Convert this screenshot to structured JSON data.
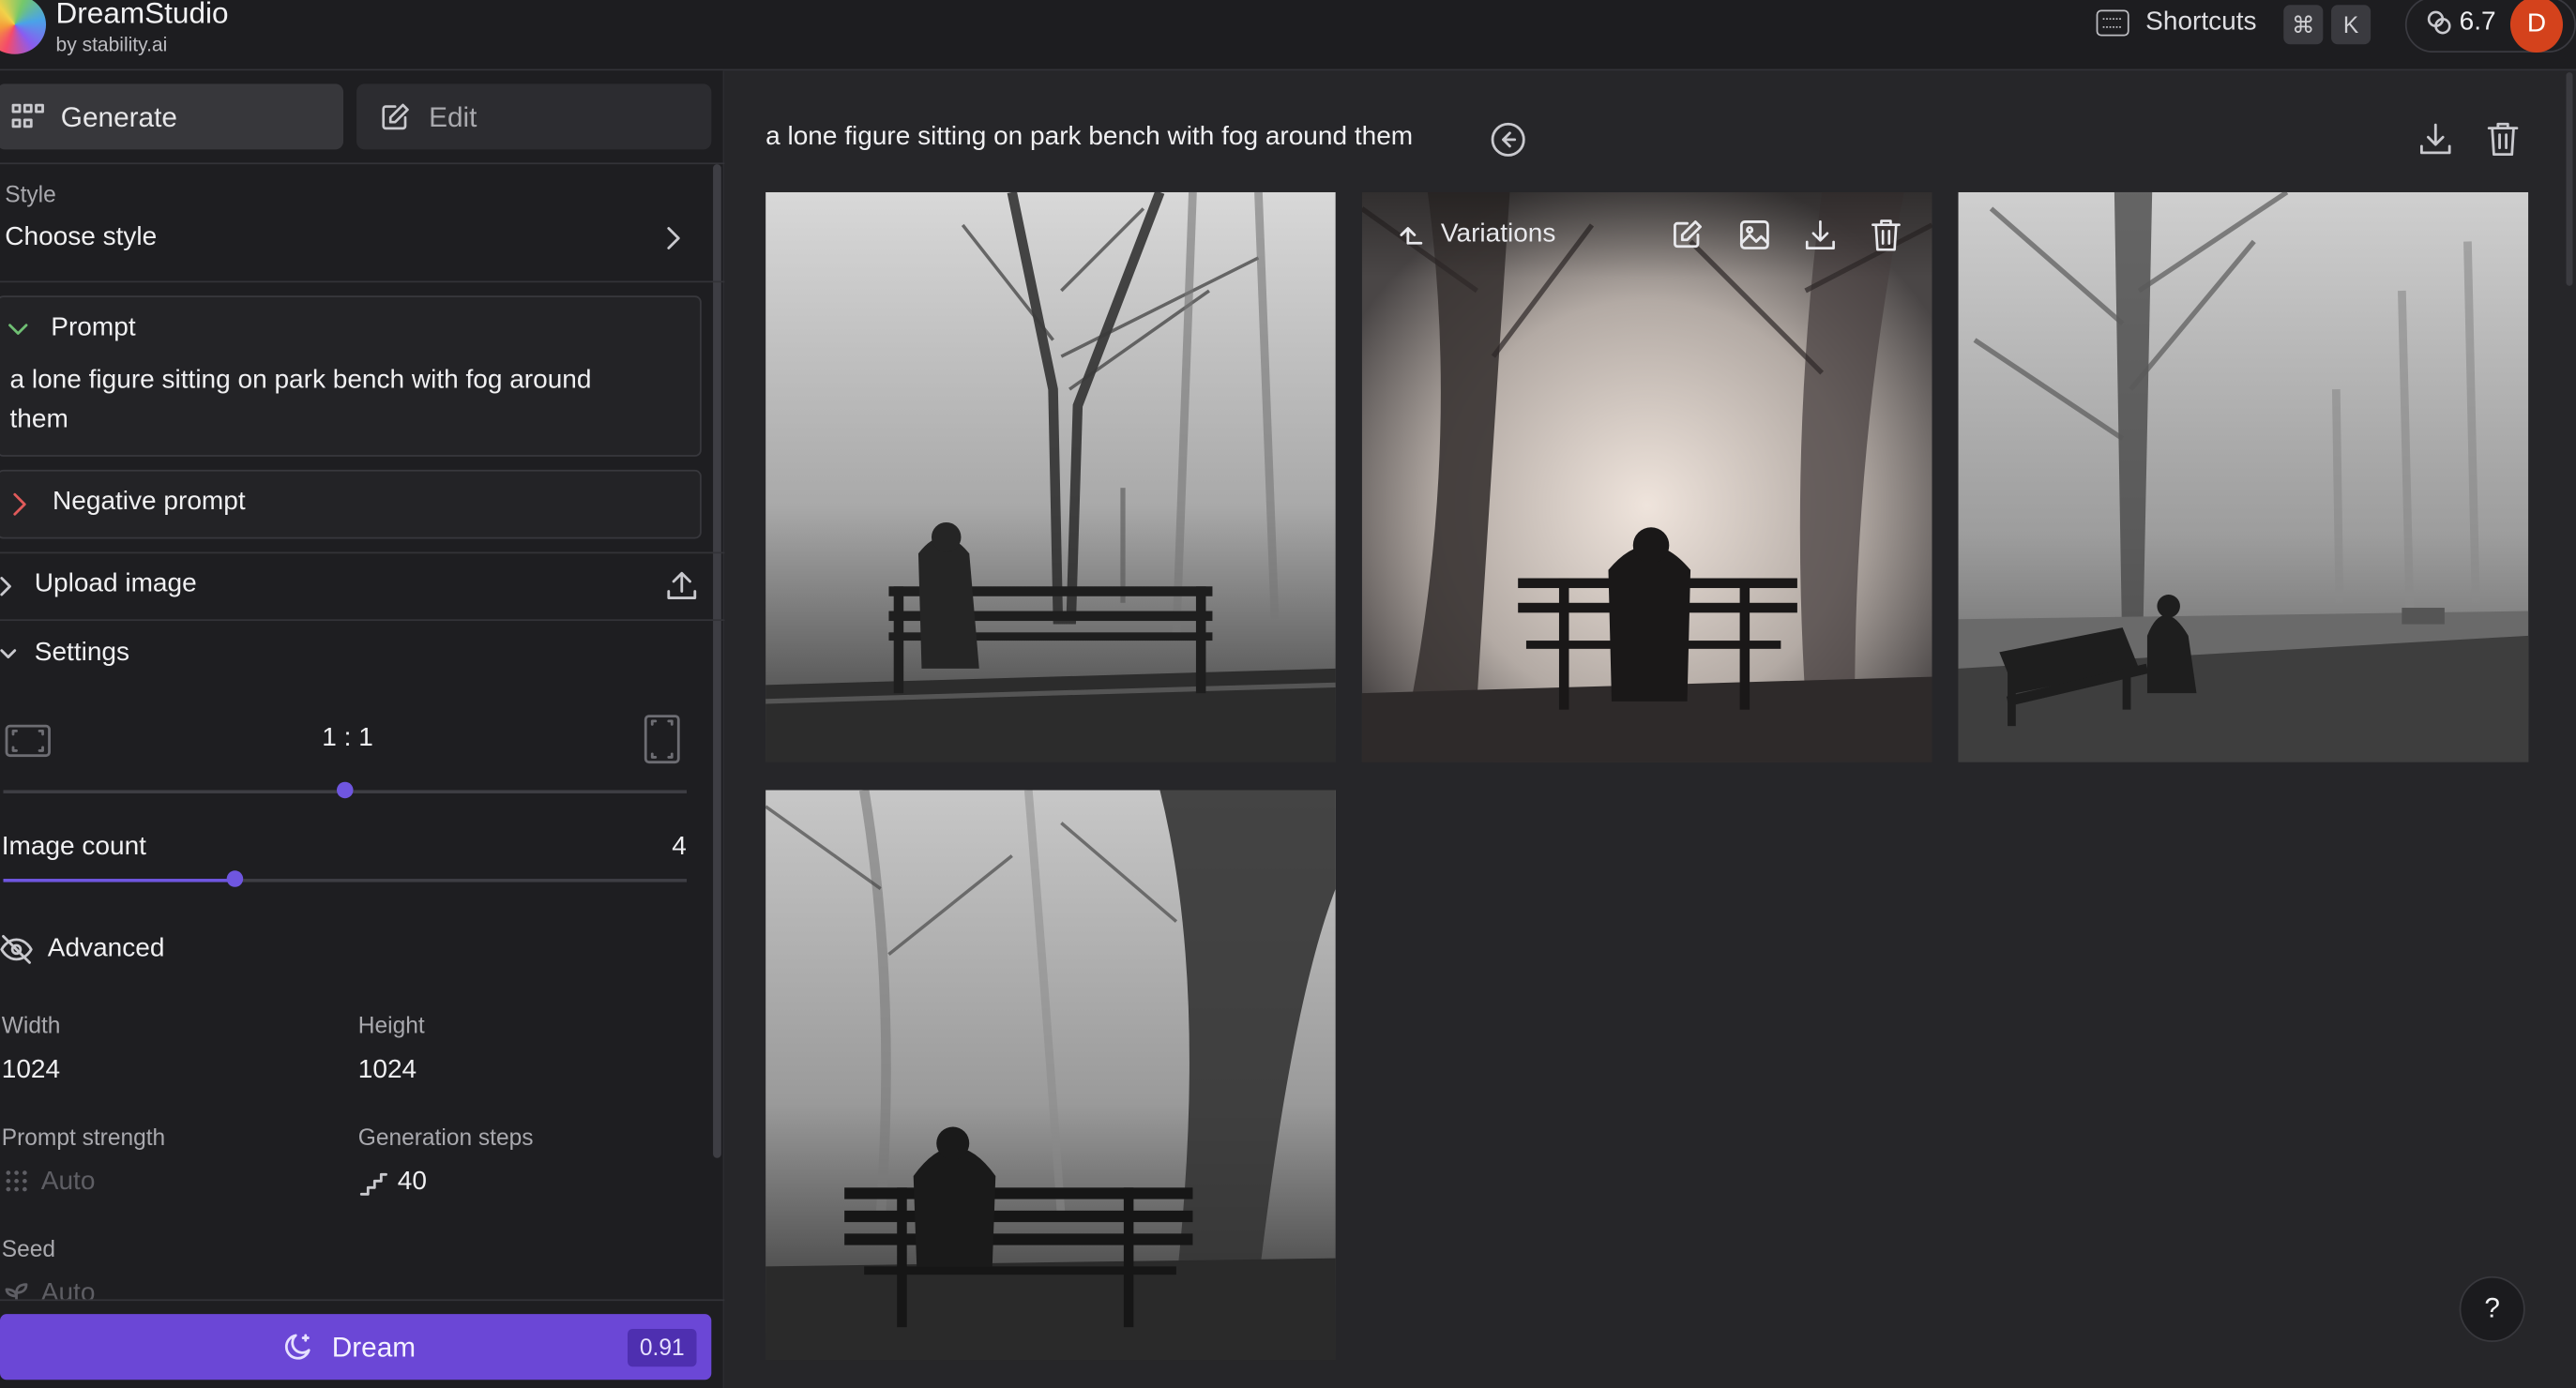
{
  "header": {
    "app_name": "DreamStudio",
    "app_sub": "by stability.ai",
    "shortcuts_label": "Shortcuts",
    "key_cmd": "⌘",
    "key_k": "K",
    "credits": "6.7",
    "avatar_initial": "D"
  },
  "sidebar": {
    "tab_generate": "Generate",
    "tab_edit": "Edit",
    "style_label": "Style",
    "style_value": "Choose style",
    "prompt_label": "Prompt",
    "prompt_text_line1": "a lone figure sitting on park bench with fog around",
    "prompt_text_line2": "them",
    "negative_prompt_label": "Negative prompt",
    "upload_image_label": "Upload image",
    "settings_label": "Settings",
    "aspect_ratio": "1 : 1",
    "aspect_ratio_slider_fraction": 0.5,
    "image_count_label": "Image count",
    "image_count_value": "4",
    "image_count_slider_fraction": 0.34,
    "advanced_label": "Advanced",
    "width_label": "Width",
    "width_value": "1024",
    "height_label": "Height",
    "height_value": "1024",
    "prompt_strength_label": "Prompt strength",
    "prompt_strength_value": "Auto",
    "generation_steps_label": "Generation steps",
    "generation_steps_value": "40",
    "seed_label": "Seed",
    "seed_value": "Auto",
    "dream_label": "Dream",
    "dream_cost": "0.91"
  },
  "main": {
    "prompt_title": "a lone figure sitting on park bench with fog around them",
    "variations_label": "Variations",
    "help_label": "?"
  },
  "colors": {
    "accent": "#6b47d6",
    "background": "#262629",
    "sidebar": "#1e1e21",
    "avatar": "#d4421c"
  }
}
